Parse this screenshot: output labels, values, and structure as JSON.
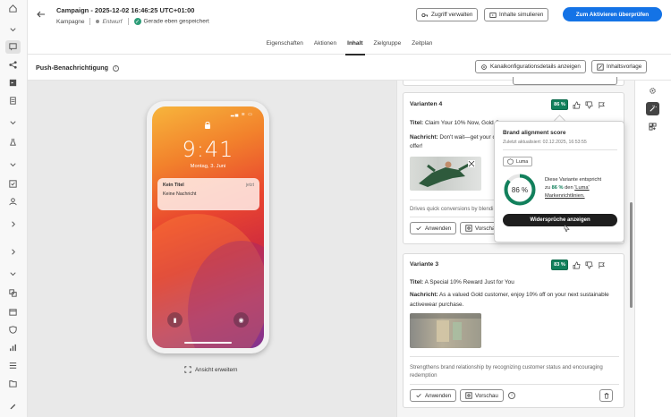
{
  "header": {
    "title": "Campaign - 2025-12-02 16:46:25 UTC+01:00",
    "type": "Kampagne",
    "status": "Entwurf",
    "saved": "Gerade eben gespeichert",
    "manage_access": "Zugriff verwalten",
    "simulate": "Inhalte simulieren",
    "activate": "Zum Aktivieren überprüfen"
  },
  "tabs": [
    "Eigenschaften",
    "Aktionen",
    "Inhalt",
    "Zielgruppe",
    "Zeitplan"
  ],
  "active_tab": "Inhalt",
  "toolbar": {
    "section_title": "Push-Benachrichtigung",
    "channel_config": "Kanalkonfigurationsdetails anzeigen",
    "content_template": "Inhaltsvorlage"
  },
  "phone": {
    "time": "9:41",
    "date": "Montag, 3. Juni",
    "notif_title": "Kein Titel",
    "notif_time": "jetzt",
    "notif_message": "Keine Nachricht",
    "expand_label": "Ansicht erweitern"
  },
  "variant4": {
    "label": "Varianten 4",
    "score": "86 %",
    "title_label": "Titel:",
    "title_value": "Claim Your 10% Now, Gold C",
    "message_label": "Nachricht:",
    "message_value_1": "Don't wait—get your c",
    "message_value_2": "offer!",
    "description": "Drives quick conversions by blendi",
    "apply": "Anwenden",
    "preview": "Vorscha"
  },
  "variant3": {
    "label": "Variante 3",
    "score": "83 %",
    "title_label": "Titel:",
    "title_value": "A Special 10% Reward Just for You",
    "message_label": "Nachricht:",
    "message_value_1": "As a valued Gold customer, enjoy 10% off on your next sustainable",
    "message_value_2": "activewear purchase.",
    "description_1": "Strengthens brand relationship by recognizing customer status and encouraging",
    "description_2": "redemption",
    "apply": "Anwenden",
    "preview": "Vorschau"
  },
  "popover": {
    "title": "Brand alignment score",
    "updated": "Zuletzt aktualisiert: 02.12.2025, 16:53:55",
    "brand": "Luma",
    "score_label": "86 %",
    "score_value": 86,
    "text_1": "Diese Variante entspricht",
    "text_2_prefix": "zu ",
    "text_2_pct": "86 %",
    "text_2_mid": " den ",
    "text_2_link": "'Luma'",
    "text_3": "Markenrichtlinien.",
    "button": "Widersprüche anzeigen"
  },
  "colors": {
    "accent": "#1473e6",
    "score_green": "#12805c"
  }
}
